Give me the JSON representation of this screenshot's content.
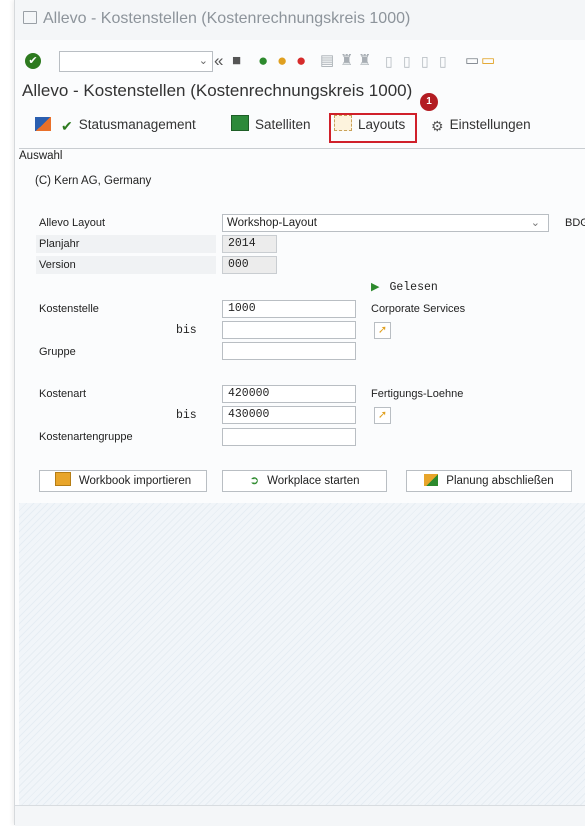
{
  "window": {
    "title": "Allevo - Kostenstellen (Kostenrechnungskreis 1000)"
  },
  "screen_title": "Allevo - Kostenstellen (Kostenrechnungskreis 1000)",
  "app_toolbar": {
    "statusmanagement": "Statusmanagement",
    "satelliten": "Satelliten",
    "layouts": "Layouts",
    "einstellungen": "Einstellungen"
  },
  "callout_number": "1",
  "section": {
    "title": "Auswahl"
  },
  "form": {
    "copyright": "(C) Kern AG, Germany",
    "layout_label": "Allevo Layout",
    "layout_value": "Workshop-Layout",
    "layout_extra": "BDGT",
    "planjahr_label": "Planjahr",
    "planjahr_value": "2014",
    "version_label": "Version",
    "version_value": "000",
    "status_text": "Gelesen",
    "kostenstelle_label": "Kostenstelle",
    "kostenstelle_value": "1000",
    "kostenstelle_desc": "Corporate Services",
    "bis_label": "bis",
    "kostenstelle_bis": "",
    "gruppe_label": "Gruppe",
    "gruppe_value": "",
    "kostenart_label": "Kostenart",
    "kostenart_value": "420000",
    "kostenart_desc": "Fertigungs-Loehne",
    "bis2_label": "bis",
    "kostenart_bis": "430000",
    "kostenartengruppe_label": "Kostenartengruppe",
    "kostenartengruppe_value": ""
  },
  "buttons": {
    "workbook": "Workbook importieren",
    "workplace": "Workplace starten",
    "planung": "Planung abschließen"
  },
  "colors": {
    "highlight": "#d0202a",
    "ok_green": "#2d7a1f",
    "accent_orange": "#e0a020"
  }
}
